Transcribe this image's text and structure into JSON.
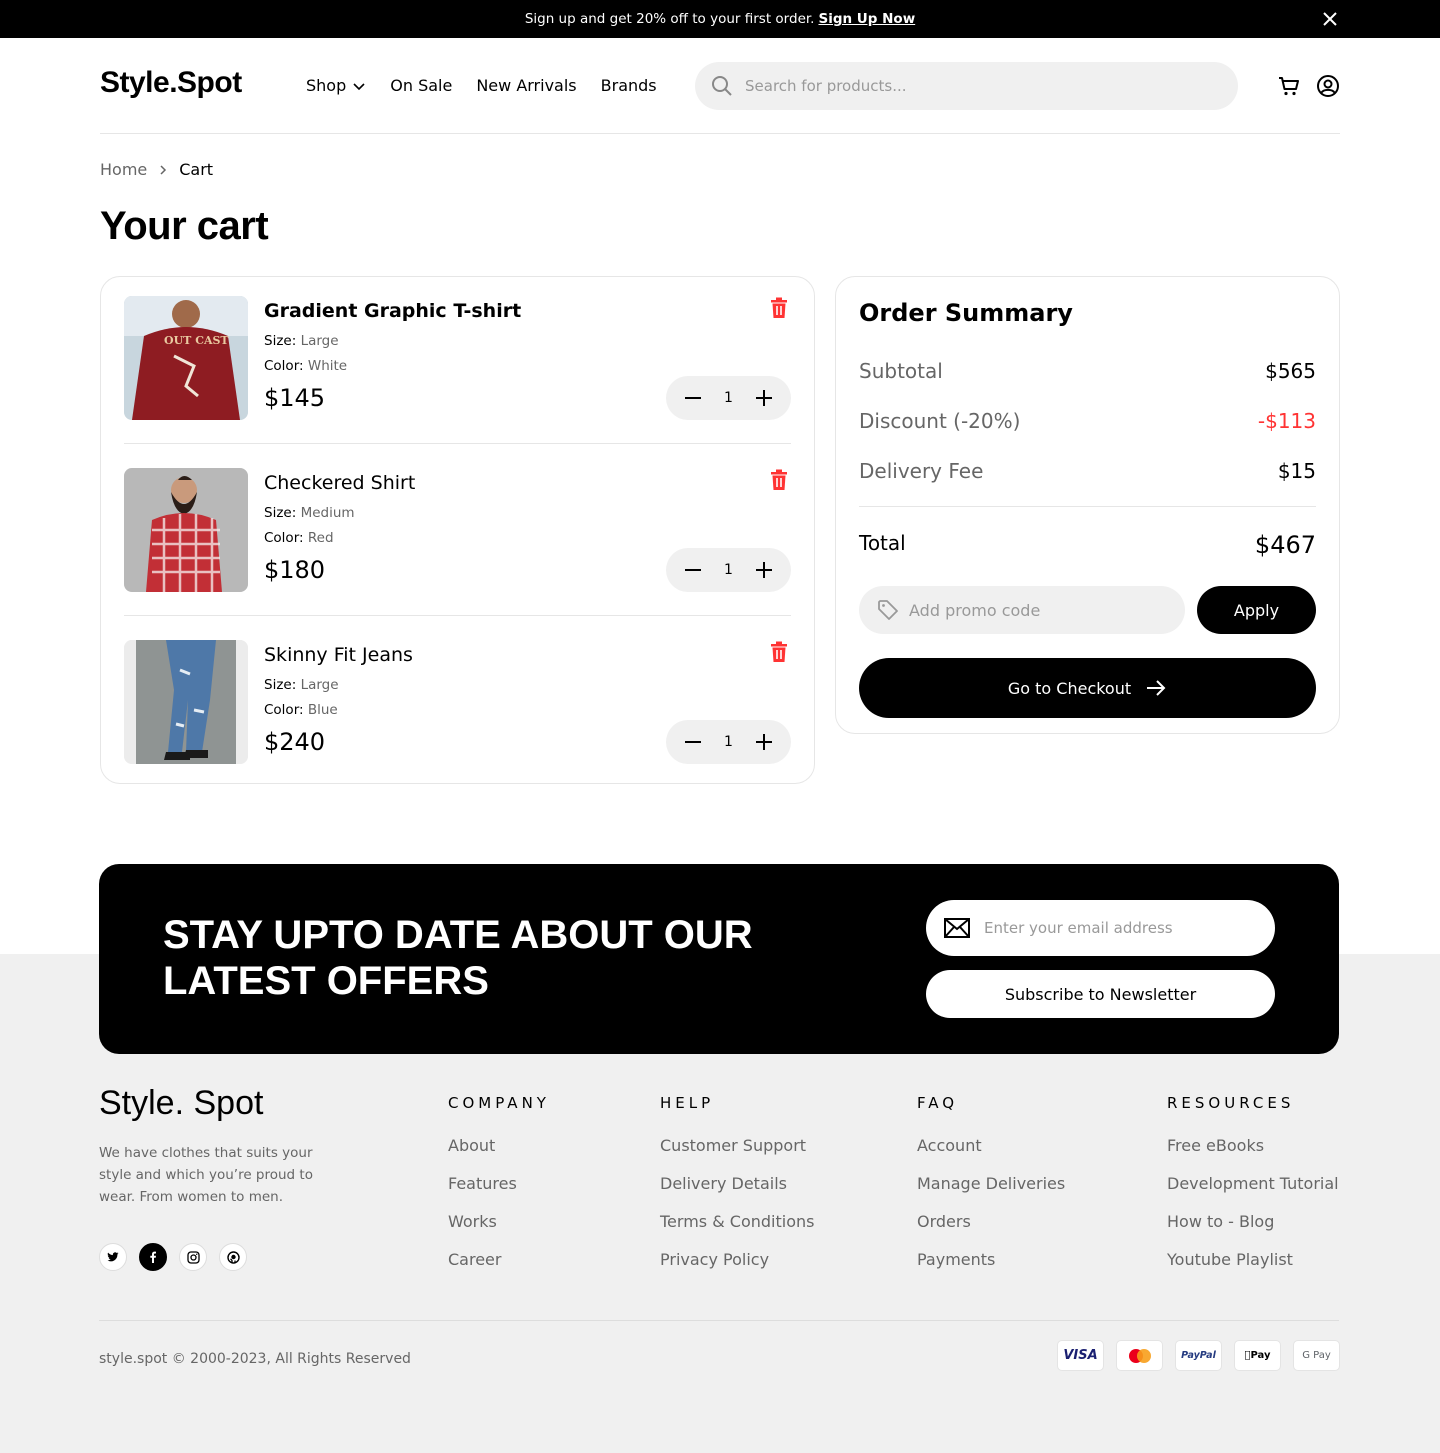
{
  "promo": {
    "text": "Sign up and get 20% off to your first order.",
    "link": "Sign Up Now"
  },
  "header": {
    "logo": "Style.Spot",
    "nav": [
      "Shop",
      "On Sale",
      "New Arrivals",
      "Brands"
    ],
    "search_placeholder": "Search for products..."
  },
  "breadcrumb": {
    "home": "Home",
    "current": "Cart"
  },
  "page_title": "Your cart",
  "cart": {
    "items": [
      {
        "name": "Gradient Graphic T-shirt",
        "size_label": "Size:",
        "size": "Large",
        "color_label": "Color:",
        "color": "White",
        "price": "$145",
        "qty": "1"
      },
      {
        "name": "Checkered Shirt",
        "size_label": "Size:",
        "size": "Medium",
        "color_label": "Color:",
        "color": "Red",
        "price": "$180",
        "qty": "1"
      },
      {
        "name": "Skinny Fit Jeans",
        "size_label": "Size:",
        "size": "Large",
        "color_label": "Color:",
        "color": "Blue",
        "price": "$240",
        "qty": "1"
      }
    ]
  },
  "summary": {
    "title": "Order Summary",
    "subtotal_label": "Subtotal",
    "subtotal": "$565",
    "discount_label": "Discount (-20%)",
    "discount": "-$113",
    "delivery_label": "Delivery Fee",
    "delivery": "$15",
    "total_label": "Total",
    "total": "$467",
    "promo_placeholder": "Add promo code",
    "apply": "Apply",
    "checkout": "Go to Checkout",
    "discount_color": "#ff3333"
  },
  "newsletter": {
    "heading": "STAY UPTO DATE ABOUT OUR LATEST OFFERS",
    "email_placeholder": "Enter your email address",
    "button": "Subscribe to Newsletter"
  },
  "footer": {
    "logo": "Style. Spot",
    "description": "We have clothes that suits your style and which you’re proud to wear. From women to men.",
    "columns": [
      {
        "title": "COMPANY",
        "links": [
          "About",
          "Features",
          "Works",
          "Career"
        ]
      },
      {
        "title": "HELP",
        "links": [
          "Customer Support",
          "Delivery Details",
          "Terms & Conditions",
          "Privacy Policy"
        ]
      },
      {
        "title": "FAQ",
        "links": [
          "Account",
          "Manage Deliveries",
          "Orders",
          "Payments"
        ]
      },
      {
        "title": "RESOURCES",
        "links": [
          "Free eBooks",
          "Development Tutorial",
          "How to - Blog",
          "Youtube Playlist"
        ]
      }
    ],
    "copyright": "style.spot © 2000-2023, All Rights Reserved",
    "payments": [
      "VISA",
      "Mastercard",
      "PayPal",
      "Pay",
      "G Pay"
    ]
  }
}
